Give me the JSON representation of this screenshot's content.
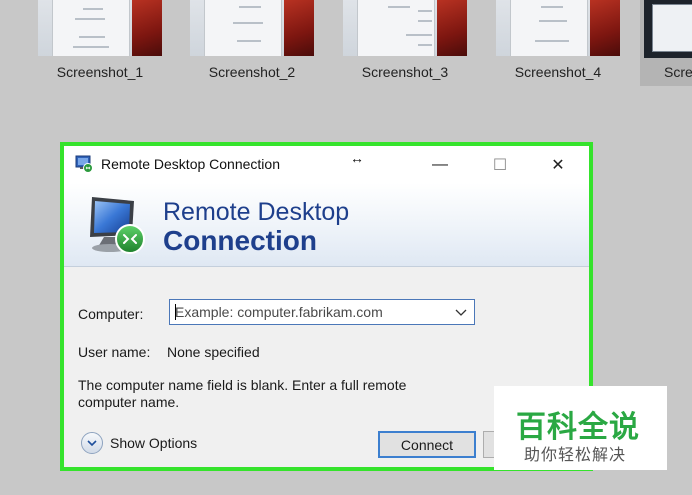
{
  "thumbnails": [
    {
      "label": "Screenshot_1"
    },
    {
      "label": "Screenshot_2"
    },
    {
      "label": "Screenshot_3"
    },
    {
      "label": "Screenshot_4"
    },
    {
      "label": "Scre"
    }
  ],
  "dialog": {
    "title": "Remote Desktop Connection",
    "resize_glyph": "↔",
    "minimize_glyph": "—",
    "maximize_glyph": "☐",
    "close_glyph": "✕",
    "banner_line1": "Remote Desktop",
    "banner_line2": "Connection",
    "computer_label": "Computer:",
    "computer_placeholder": "Example: computer.fabrikam.com",
    "computer_value": "",
    "username_label": "User name:",
    "username_value": "None specified",
    "message": "The computer name field is blank. Enter a full remote computer name.",
    "show_options_label": "Show Options",
    "connect_label": "Connect",
    "accent_color": "#35e32c"
  },
  "watermark": {
    "line1": "百科全说",
    "line2": "助你轻松解决"
  }
}
